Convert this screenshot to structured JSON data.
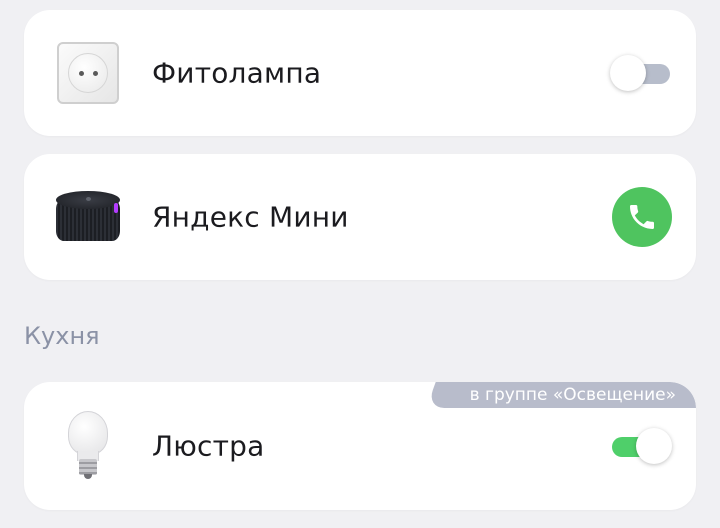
{
  "devices": [
    {
      "name": "Фитолампа",
      "icon": "socket-icon",
      "control": "toggle",
      "state": "off"
    },
    {
      "name": "Яндекс Мини",
      "icon": "smart-speaker-icon",
      "control": "call-button"
    }
  ],
  "sections": [
    {
      "title": "Кухня",
      "devices": [
        {
          "name": "Люстра",
          "icon": "light-bulb-icon",
          "badge": "в группе «Освещение»",
          "control": "toggle",
          "state": "on"
        }
      ]
    }
  ],
  "colors": {
    "toggle_on": "#4fcf6a",
    "toggle_off": "#b7bdcb",
    "call_button": "#4fc45f",
    "section_title": "#8b92a6",
    "badge": "#b8bccb"
  }
}
